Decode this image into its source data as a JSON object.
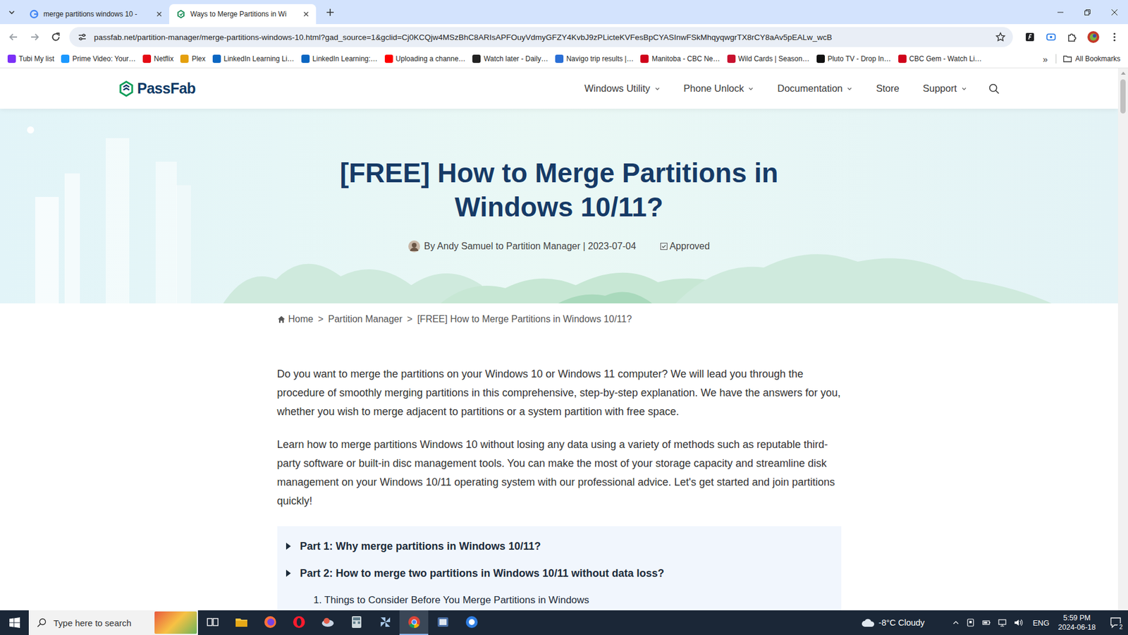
{
  "browser": {
    "tabs": [
      {
        "title": "merge partitions windows 10 -",
        "selected": false
      },
      {
        "title": "Ways to Merge Partitions in Wi",
        "selected": true
      }
    ],
    "address": "passfab.net/partition-manager/merge-partitions-windows-10.html?gad_source=1&gclid=Cj0KCQjw4MSzBhC8ARIsAPFOuyVdmyGFZY4KvbJ9zPLicteKVFesBpCYASInwFSkMhqyqwgrTX8rCY8aAv5pEALw_wcB",
    "bookmarks": [
      {
        "label": "Tubi My list",
        "color": "#7b2ff7"
      },
      {
        "label": "Prime Video: Your…",
        "color": "#1a98ff"
      },
      {
        "label": "Netflix",
        "color": "#e50914"
      },
      {
        "label": "Plex",
        "color": "#e5a00d"
      },
      {
        "label": "LinkedIn Learning Li…",
        "color": "#0a66c2"
      },
      {
        "label": "LinkedIn Learning:…",
        "color": "#0a66c2"
      },
      {
        "label": "Uploading a channe…",
        "color": "#ff0000"
      },
      {
        "label": "Watch later - Daily…",
        "color": "#222222"
      },
      {
        "label": "Navigo trip results |…",
        "color": "#2a6fd6"
      },
      {
        "label": "Manitoba - CBC Ne…",
        "color": "#d0021b"
      },
      {
        "label": "Wild Cards | Season…",
        "color": "#c8102e"
      },
      {
        "label": "Pluto TV - Drop In…",
        "color": "#111111"
      },
      {
        "label": "CBC Gem - Watch Li…",
        "color": "#d0021b"
      }
    ],
    "more": "»",
    "all_bookmarks": "All Bookmarks"
  },
  "site": {
    "logo": "PassFab",
    "nav": [
      {
        "label": "Windows Utility",
        "dropdown": true
      },
      {
        "label": "Phone Unlock",
        "dropdown": true
      },
      {
        "label": "Documentation",
        "dropdown": true
      },
      {
        "label": "Store",
        "dropdown": false
      },
      {
        "label": "Support",
        "dropdown": true
      }
    ]
  },
  "article": {
    "title": "[FREE] How to Merge Partitions in Windows 10/11?",
    "byline": "By Andy Samuel to Partition Manager | 2023-07-04",
    "badge": "Approved",
    "breadcrumb": [
      "Home",
      "Partition Manager",
      "[FREE] How to Merge Partitions in Windows 10/11?"
    ],
    "separator": ">",
    "paragraphs": [
      "Do you want to merge the partitions on your Windows 10 or Windows 11 computer? We will lead you through the procedure of smoothly merging partitions in this comprehensive, step-by-step explanation. We have the answers for you, whether you wish to merge adjacent to partitions or a system partition with free space.",
      "Learn how to merge partitions Windows 10 without losing any data using a variety of methods such as reputable third-party software or built-in disc management tools. You can make the most of your storage capacity and streamline disk management on your Windows 10/11 operating system with our professional advice. Let's get started and join partitions quickly!"
    ],
    "toc": [
      {
        "label": "Part 1: Why merge partitions in Windows 10/11?",
        "kind": "part"
      },
      {
        "label": "Part 2: How to merge two partitions in Windows 10/11 without data loss?",
        "kind": "part"
      },
      {
        "label": "1. Things to Consider Before You Merge Partitions in Windows",
        "kind": "sub"
      }
    ]
  },
  "taskbar": {
    "search_placeholder": "Type here to search",
    "apps": [
      {
        "selected": false
      },
      {
        "selected": false
      },
      {
        "selected": false
      },
      {
        "selected": false
      },
      {
        "selected": false
      },
      {
        "selected": false
      },
      {
        "selected": false
      },
      {
        "selected": true
      },
      {
        "selected": false
      },
      {
        "selected": false
      }
    ],
    "weather": "-8°C Cloudy",
    "language": "ENG",
    "time": "5:59 PM",
    "date": "2024-06-18",
    "notifications": "2"
  }
}
